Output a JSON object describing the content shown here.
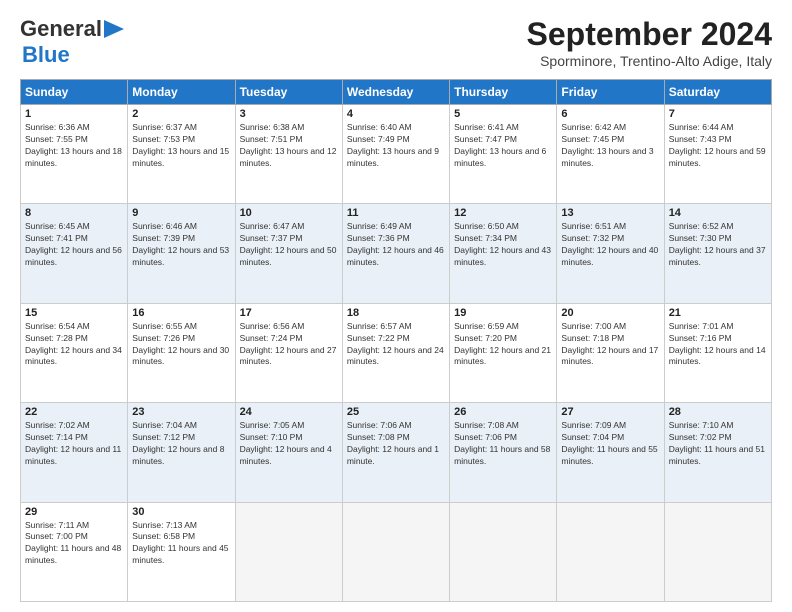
{
  "header": {
    "logo_line1": "General",
    "logo_line2": "Blue",
    "month": "September 2024",
    "location": "Sporminore, Trentino-Alto Adige, Italy"
  },
  "days_of_week": [
    "Sunday",
    "Monday",
    "Tuesday",
    "Wednesday",
    "Thursday",
    "Friday",
    "Saturday"
  ],
  "weeks": [
    [
      {
        "day": "1",
        "sunrise": "Sunrise: 6:36 AM",
        "sunset": "Sunset: 7:55 PM",
        "daylight": "Daylight: 13 hours and 18 minutes."
      },
      {
        "day": "2",
        "sunrise": "Sunrise: 6:37 AM",
        "sunset": "Sunset: 7:53 PM",
        "daylight": "Daylight: 13 hours and 15 minutes."
      },
      {
        "day": "3",
        "sunrise": "Sunrise: 6:38 AM",
        "sunset": "Sunset: 7:51 PM",
        "daylight": "Daylight: 13 hours and 12 minutes."
      },
      {
        "day": "4",
        "sunrise": "Sunrise: 6:40 AM",
        "sunset": "Sunset: 7:49 PM",
        "daylight": "Daylight: 13 hours and 9 minutes."
      },
      {
        "day": "5",
        "sunrise": "Sunrise: 6:41 AM",
        "sunset": "Sunset: 7:47 PM",
        "daylight": "Daylight: 13 hours and 6 minutes."
      },
      {
        "day": "6",
        "sunrise": "Sunrise: 6:42 AM",
        "sunset": "Sunset: 7:45 PM",
        "daylight": "Daylight: 13 hours and 3 minutes."
      },
      {
        "day": "7",
        "sunrise": "Sunrise: 6:44 AM",
        "sunset": "Sunset: 7:43 PM",
        "daylight": "Daylight: 12 hours and 59 minutes."
      }
    ],
    [
      {
        "day": "8",
        "sunrise": "Sunrise: 6:45 AM",
        "sunset": "Sunset: 7:41 PM",
        "daylight": "Daylight: 12 hours and 56 minutes."
      },
      {
        "day": "9",
        "sunrise": "Sunrise: 6:46 AM",
        "sunset": "Sunset: 7:39 PM",
        "daylight": "Daylight: 12 hours and 53 minutes."
      },
      {
        "day": "10",
        "sunrise": "Sunrise: 6:47 AM",
        "sunset": "Sunset: 7:37 PM",
        "daylight": "Daylight: 12 hours and 50 minutes."
      },
      {
        "day": "11",
        "sunrise": "Sunrise: 6:49 AM",
        "sunset": "Sunset: 7:36 PM",
        "daylight": "Daylight: 12 hours and 46 minutes."
      },
      {
        "day": "12",
        "sunrise": "Sunrise: 6:50 AM",
        "sunset": "Sunset: 7:34 PM",
        "daylight": "Daylight: 12 hours and 43 minutes."
      },
      {
        "day": "13",
        "sunrise": "Sunrise: 6:51 AM",
        "sunset": "Sunset: 7:32 PM",
        "daylight": "Daylight: 12 hours and 40 minutes."
      },
      {
        "day": "14",
        "sunrise": "Sunrise: 6:52 AM",
        "sunset": "Sunset: 7:30 PM",
        "daylight": "Daylight: 12 hours and 37 minutes."
      }
    ],
    [
      {
        "day": "15",
        "sunrise": "Sunrise: 6:54 AM",
        "sunset": "Sunset: 7:28 PM",
        "daylight": "Daylight: 12 hours and 34 minutes."
      },
      {
        "day": "16",
        "sunrise": "Sunrise: 6:55 AM",
        "sunset": "Sunset: 7:26 PM",
        "daylight": "Daylight: 12 hours and 30 minutes."
      },
      {
        "day": "17",
        "sunrise": "Sunrise: 6:56 AM",
        "sunset": "Sunset: 7:24 PM",
        "daylight": "Daylight: 12 hours and 27 minutes."
      },
      {
        "day": "18",
        "sunrise": "Sunrise: 6:57 AM",
        "sunset": "Sunset: 7:22 PM",
        "daylight": "Daylight: 12 hours and 24 minutes."
      },
      {
        "day": "19",
        "sunrise": "Sunrise: 6:59 AM",
        "sunset": "Sunset: 7:20 PM",
        "daylight": "Daylight: 12 hours and 21 minutes."
      },
      {
        "day": "20",
        "sunrise": "Sunrise: 7:00 AM",
        "sunset": "Sunset: 7:18 PM",
        "daylight": "Daylight: 12 hours and 17 minutes."
      },
      {
        "day": "21",
        "sunrise": "Sunrise: 7:01 AM",
        "sunset": "Sunset: 7:16 PM",
        "daylight": "Daylight: 12 hours and 14 minutes."
      }
    ],
    [
      {
        "day": "22",
        "sunrise": "Sunrise: 7:02 AM",
        "sunset": "Sunset: 7:14 PM",
        "daylight": "Daylight: 12 hours and 11 minutes."
      },
      {
        "day": "23",
        "sunrise": "Sunrise: 7:04 AM",
        "sunset": "Sunset: 7:12 PM",
        "daylight": "Daylight: 12 hours and 8 minutes."
      },
      {
        "day": "24",
        "sunrise": "Sunrise: 7:05 AM",
        "sunset": "Sunset: 7:10 PM",
        "daylight": "Daylight: 12 hours and 4 minutes."
      },
      {
        "day": "25",
        "sunrise": "Sunrise: 7:06 AM",
        "sunset": "Sunset: 7:08 PM",
        "daylight": "Daylight: 12 hours and 1 minute."
      },
      {
        "day": "26",
        "sunrise": "Sunrise: 7:08 AM",
        "sunset": "Sunset: 7:06 PM",
        "daylight": "Daylight: 11 hours and 58 minutes."
      },
      {
        "day": "27",
        "sunrise": "Sunrise: 7:09 AM",
        "sunset": "Sunset: 7:04 PM",
        "daylight": "Daylight: 11 hours and 55 minutes."
      },
      {
        "day": "28",
        "sunrise": "Sunrise: 7:10 AM",
        "sunset": "Sunset: 7:02 PM",
        "daylight": "Daylight: 11 hours and 51 minutes."
      }
    ],
    [
      {
        "day": "29",
        "sunrise": "Sunrise: 7:11 AM",
        "sunset": "Sunset: 7:00 PM",
        "daylight": "Daylight: 11 hours and 48 minutes."
      },
      {
        "day": "30",
        "sunrise": "Sunrise: 7:13 AM",
        "sunset": "Sunset: 6:58 PM",
        "daylight": "Daylight: 11 hours and 45 minutes."
      },
      null,
      null,
      null,
      null,
      null
    ]
  ]
}
